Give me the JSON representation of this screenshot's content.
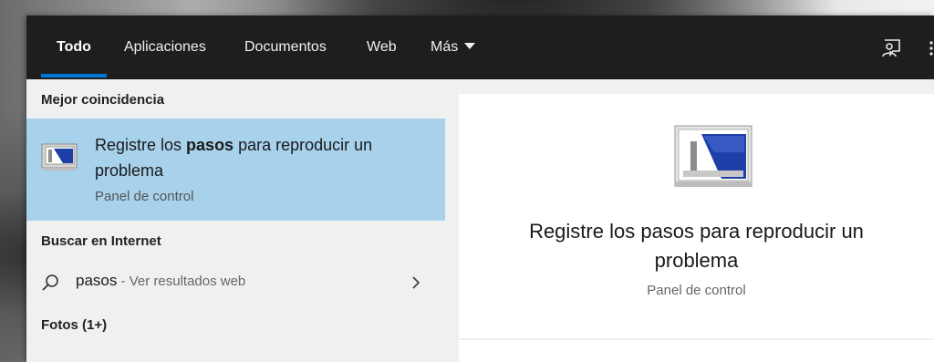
{
  "tabs": [
    {
      "label": "Todo",
      "active": true
    },
    {
      "label": "Aplicaciones"
    },
    {
      "label": "Documentos"
    },
    {
      "label": "Web"
    },
    {
      "label": "Más"
    }
  ],
  "sections": {
    "best_match": "Mejor coincidencia",
    "web_search": "Buscar en Internet",
    "photos": "Fotos (1+)"
  },
  "best_result": {
    "title_before": "Registre los ",
    "title_bold": "pasos",
    "title_after": " para reproducir un problema",
    "subtitle": "Panel de control",
    "icon": "steps-recorder-icon"
  },
  "web_result": {
    "query": "pasos",
    "hint": " - Ver resultados web"
  },
  "preview": {
    "title": "Registre los pasos para reproducir un problema",
    "subtitle": "Panel de control"
  },
  "colors": {
    "topbar": "#1e1e1e",
    "accent": "#0078d7",
    "selected": "#a8d1ec"
  }
}
